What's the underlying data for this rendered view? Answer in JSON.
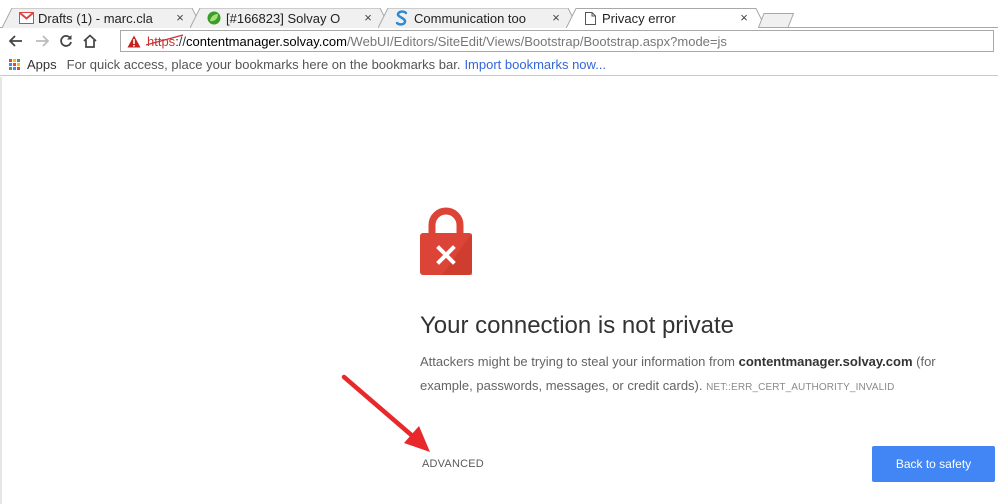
{
  "colors": {
    "accent": "#4285f4",
    "lock_red": "#db4437",
    "warning_red": "#c33",
    "annotation_arrow": "#e8282b"
  },
  "tabs": [
    {
      "title": "Drafts (1) - marc.cla",
      "icon": "gmail-icon",
      "active": false
    },
    {
      "title": "[#166823] Solvay O",
      "icon": "leaf-icon",
      "active": false
    },
    {
      "title": "Communication too",
      "icon": "s-logo-icon",
      "active": false
    },
    {
      "title": "Privacy error",
      "icon": "page-icon",
      "active": true
    }
  ],
  "tab_close_glyph": "×",
  "omnibox": {
    "scheme": "https",
    "host_prefix": "://",
    "host": "contentmanager.solvay.com",
    "path": "/WebUI/Editors/SiteEdit/Views/Bootstrap/Bootstrap.aspx?mode=js"
  },
  "bookmarks": {
    "apps_label": "Apps",
    "hint": "For quick access, place your bookmarks here on the bookmarks bar.",
    "import_link": "Import bookmarks now..."
  },
  "interstitial": {
    "heading": "Your connection is not private",
    "text_before": "Attackers might be trying to steal your information from ",
    "domain": "contentmanager.solvay.com",
    "text_after": " (for example, passwords, messages, or credit cards). ",
    "error_code": "NET::ERR_CERT_AUTHORITY_INVALID",
    "advanced_label": "ADVANCED",
    "back_button": "Back to safety"
  }
}
